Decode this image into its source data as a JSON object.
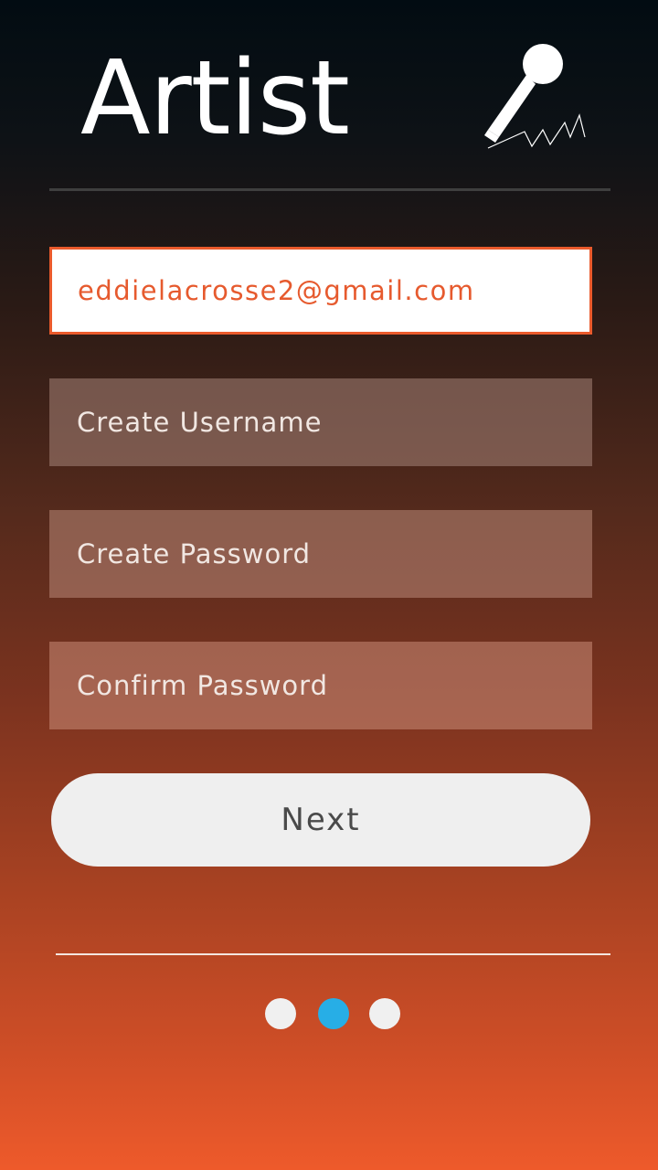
{
  "header": {
    "title": "Artist",
    "icon": "microphone-icon"
  },
  "form": {
    "email_value": "eddielacrosse2@gmail.com",
    "username_placeholder": "Create Username",
    "password_placeholder": "Create Password",
    "confirm_placeholder": "Confirm Password"
  },
  "actions": {
    "next_label": "Next"
  },
  "pagination": {
    "total_pages": 3,
    "current_page": 2
  },
  "colors": {
    "accent": "#ea5a2c",
    "active_dot": "#27aee6",
    "button_bg": "#efefef"
  }
}
